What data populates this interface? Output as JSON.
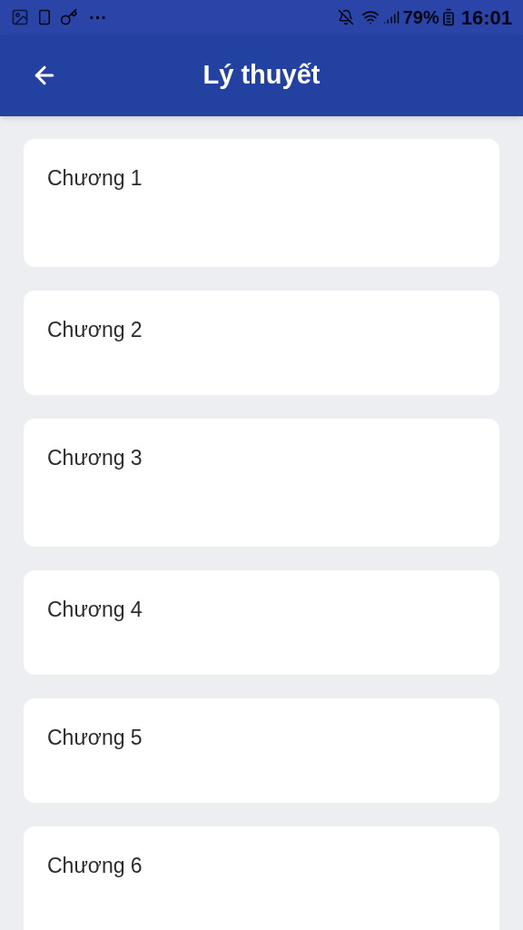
{
  "status_bar": {
    "battery": "79%",
    "time": "16:01",
    "more": "···"
  },
  "app_bar": {
    "title": "Lý thuyết"
  },
  "chapters": [
    {
      "title": "Chương 1",
      "kind": "tall"
    },
    {
      "title": "Chương 2",
      "kind": "short"
    },
    {
      "title": "Chương 3",
      "kind": "tall"
    },
    {
      "title": "Chương 4",
      "kind": "short"
    },
    {
      "title": "Chương 5",
      "kind": "short"
    },
    {
      "title": "Chương 6",
      "kind": "tall"
    }
  ]
}
